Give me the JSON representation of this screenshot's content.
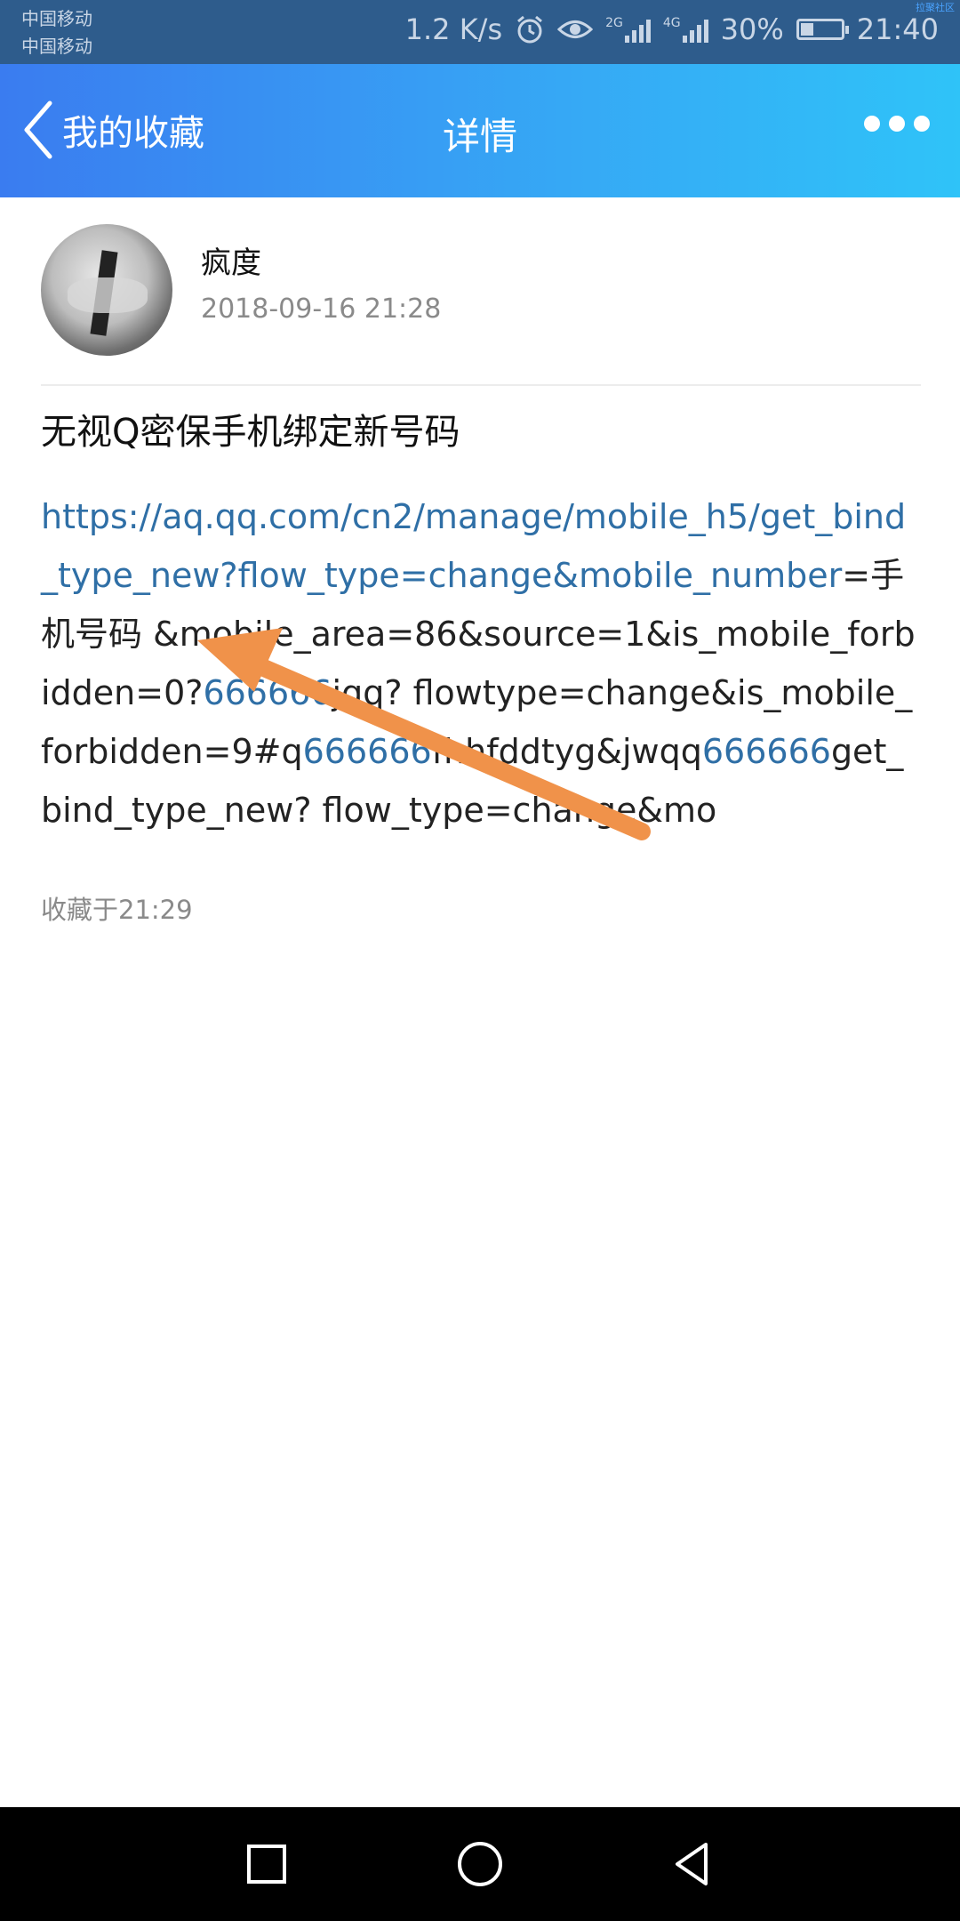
{
  "status_bar": {
    "carrier_1": "中国移动",
    "carrier_2": "中国移动",
    "net_speed": "1.2 K/s",
    "signal_1_type": "2G",
    "signal_2_type": "4G",
    "battery": "30%",
    "battery_level": 0.3,
    "time": "21:40",
    "corner_mark": "拉聚社区",
    "icons": [
      "alarm-icon",
      "eye-icon",
      "signal-icon",
      "battery-icon"
    ]
  },
  "header": {
    "back_label": "我的收藏",
    "title": "详情",
    "more_icon": "more-dots-icon"
  },
  "post": {
    "author": "疯度",
    "timestamp": "2018-09-16 21:28",
    "title": "无视Q密保手机绑定新号码",
    "body": {
      "link_1": "https://aq.qq.com/cn2/manage/mobile_h5/get_bind_type_new?flow_type=change&mobile_number",
      "text_1": "=手机号码 &mobile_area=86&source=1&is_mobile_forbidden=0?",
      "link_2": "666666",
      "text_2": "jqq? flowtype=change&is_mobile_forbidden=9#q",
      "link_3": "666666",
      "text_3": "fhhfddtyg&jwqq",
      "link_4": "666666",
      "text_4": "get_bind_type_new? flow_type=change&mo"
    },
    "saved_at": "收藏于21:29"
  },
  "nav_bar": {
    "buttons": [
      "recent-apps-button",
      "home-button",
      "back-button"
    ]
  },
  "colors": {
    "header_start": "#3a7cf0",
    "header_end": "#2fc3f8",
    "link": "#2f6fa6",
    "annotation_arrow": "#f0924a"
  }
}
